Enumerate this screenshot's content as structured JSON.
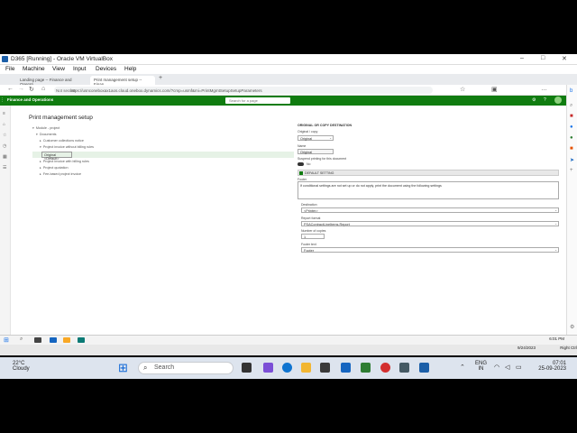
{
  "vm": {
    "title": "D365 [Running] - Oracle VM VirtualBox",
    "menu": [
      "File",
      "Machine",
      "View",
      "Input",
      "Devices",
      "Help"
    ],
    "host_key": "Right Ctrl"
  },
  "browser": {
    "tabs": [
      {
        "label": "Landing page -- Finance and Operati"
      },
      {
        "label": "Print management setup -- Finan"
      }
    ],
    "addr_prefix": "Not secure",
    "url": "https://usnconeboxax1aos.cloud.onebox.dynamics.com/?cmp=usmf&mi=PrintMgmtSetupSetupParameters"
  },
  "d365": {
    "app_name": "Finance and Operations",
    "search_placeholder": "Search for a page"
  },
  "page": {
    "title": "Print management setup",
    "tree": [
      {
        "label": "Module - project",
        "level": 0
      },
      {
        "label": "Documents",
        "level": 1
      },
      {
        "label": "Customer collections notice",
        "level": 2
      },
      {
        "label": "Project invoice without billing rules",
        "level": 2
      },
      {
        "label": "Original <Default>",
        "level": 3
      },
      {
        "label": "Project invoice with billing rules",
        "level": 2
      },
      {
        "label": "Project quotation",
        "level": 2
      },
      {
        "label": "Fee-based project invoice",
        "level": 2
      }
    ],
    "selected_node": "Original <Default>"
  },
  "details": {
    "section_header": "ORIGINAL OR COPY DESTINATION",
    "original_copy_label": "Original / copy",
    "original_copy_value": "Original",
    "name_label": "Name",
    "name_value": "Original",
    "suspend_label": "Suspend printing for this document",
    "suspend_value": "No",
    "override_label": "DEFAULT SETTING",
    "footer_label": "Footer",
    "footer_text": "If conditional settings are not set up or do not apply, print the document using the following settings",
    "destination_label": "Destination",
    "destination_value": "<Printer>",
    "report_format_label": "Report format",
    "report_format_value": "PSAContractLineItems.Report",
    "copies_label": "Number of copies",
    "copies_value": "1",
    "footer2_label": "Footer text",
    "footer2_value": "Footer"
  },
  "vm_status": {
    "time": "6:01 PM",
    "date": "9/24/2023"
  },
  "taskbar": {
    "weather_temp": "22°C",
    "weather_cond": "Cloudy",
    "search": "Search",
    "lang": "ENG",
    "region": "IN",
    "time": "07:01",
    "date": "25-09-2023"
  }
}
